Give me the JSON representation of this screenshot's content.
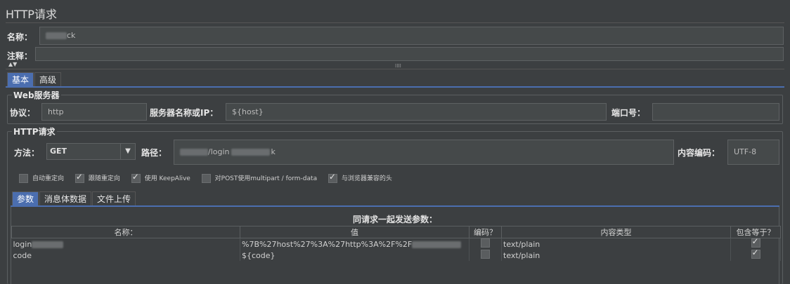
{
  "title": "HTTP请求",
  "name_label": "名称：",
  "name_value": "ck",
  "comment_label": "注释：",
  "tabs": [
    {
      "label": "基本",
      "active": true
    },
    {
      "label": "高级",
      "active": false
    }
  ],
  "web_server": {
    "group_title": "Web服务器",
    "protocol_label": "协议：",
    "protocol_value": "http",
    "server_label": "服务器名称或IP：",
    "server_value": "${host}",
    "port_label": "端口号：",
    "port_value": ""
  },
  "http_request": {
    "group_title": "HTTP请求",
    "method_label": "方法：",
    "method_value": "GET",
    "path_label": "路径：",
    "path_value_a": "/login",
    "path_value_b": "k",
    "encoding_label": "内容编码：",
    "encoding_value": "UTF-8",
    "options": [
      {
        "label": "自动重定向",
        "checked": false
      },
      {
        "label": "跟随重定向",
        "checked": true
      },
      {
        "label": "使用 KeepAlive",
        "checked": true
      },
      {
        "label": "对POST使用multipart / form-data",
        "checked": false
      },
      {
        "label": "与浏览器兼容的头",
        "checked": true
      }
    ]
  },
  "param_tabs": [
    {
      "label": "参数",
      "active": true
    },
    {
      "label": "消息体数据",
      "active": false
    },
    {
      "label": "文件上传",
      "active": false
    }
  ],
  "params_title": "同请求一起发送参数：",
  "params_columns": [
    "名称：",
    "值",
    "编码？",
    "内容类型",
    "包含等于？"
  ],
  "params_rows": [
    {
      "name": "login",
      "value": "%7B%27host%27%3A%27http%3A%2F%2F",
      "encode": false,
      "content_type": "text/plain",
      "include_equals": true
    },
    {
      "name": "code",
      "value": "${code}",
      "encode": false,
      "content_type": "text/plain",
      "include_equals": true
    }
  ]
}
